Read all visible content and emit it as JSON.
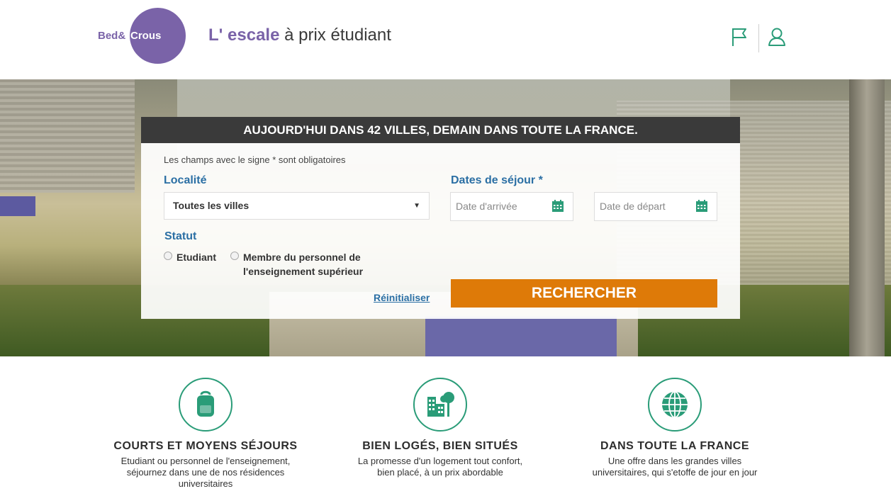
{
  "header": {
    "logo_bed": "Bed",
    "logo_crous": "Crous",
    "tagline_accent": "L' escale",
    "tagline_rest": " à prix étudiant",
    "icons": [
      "flag-icon",
      "user-icon"
    ],
    "accent_color": "#7a63a8",
    "icon_color": "#2a9c78"
  },
  "search": {
    "banner": "AUJOURD'HUI DANS 42 VILLES, DEMAIN DANS TOUTE LA FRANCE.",
    "required_note": "Les champs avec le signe * sont obligatoires",
    "locality_label": "Localité",
    "locality_value": "Toutes les villes",
    "dates_label": "Dates de séjour *",
    "arrival_placeholder": "Date d'arrivée",
    "departure_placeholder": "Date de départ",
    "status_label": "Statut",
    "status_option_1": "Etudiant",
    "status_option_2_line1": "Membre du personnel de",
    "status_option_2_line2": "l'enseignement supérieur",
    "reset_label": "Réinitialiser",
    "search_label": "RECHERCHER",
    "button_color": "#de7a08"
  },
  "features": [
    {
      "icon": "backpack-icon",
      "title": "COURTS ET MOYENS SÉJOURS",
      "line1": "Etudiant ou personnel de l'enseignement,",
      "line2": "séjournez dans une de nos résidences",
      "line3": "universitaires"
    },
    {
      "icon": "city-icon",
      "title": "BIEN LOGÉS, BIEN SITUÉS",
      "line1": "La promesse d'un logement tout confort,",
      "line2": "bien placé, à un prix abordable",
      "line3": ""
    },
    {
      "icon": "globe-icon",
      "title": "DANS TOUTE LA FRANCE",
      "line1": "Une offre dans les grandes villes",
      "line2": "universitaires, qui s'etoffe de jour en jour",
      "line3": ""
    }
  ]
}
